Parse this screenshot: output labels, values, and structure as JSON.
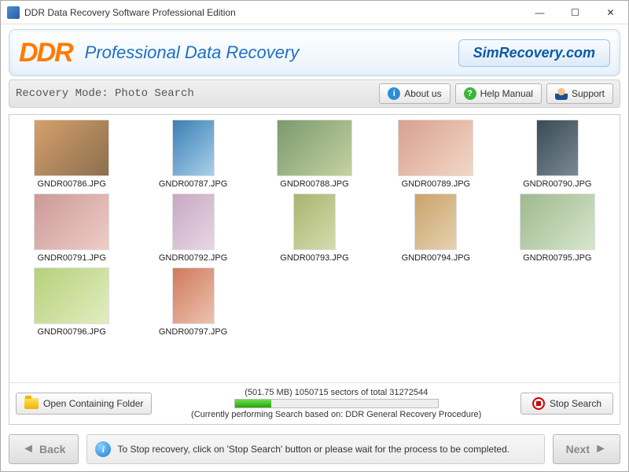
{
  "window": {
    "title": "DDR Data Recovery Software Professional Edition"
  },
  "banner": {
    "logo": "DDR",
    "title": "Professional Data Recovery",
    "brand": "SimRecovery.com"
  },
  "toolbar": {
    "mode_label": "Recovery Mode: Photo Search",
    "about": "About us",
    "help": "Help Manual",
    "support": "Support"
  },
  "files": [
    {
      "name": "GNDR00786.JPG",
      "orient": "land"
    },
    {
      "name": "GNDR00787.JPG",
      "orient": "port"
    },
    {
      "name": "GNDR00788.JPG",
      "orient": "land"
    },
    {
      "name": "GNDR00789.JPG",
      "orient": "land"
    },
    {
      "name": "GNDR00790.JPG",
      "orient": "port"
    },
    {
      "name": "GNDR00791.JPG",
      "orient": "land"
    },
    {
      "name": "GNDR00792.JPG",
      "orient": "port"
    },
    {
      "name": "GNDR00793.JPG",
      "orient": "port"
    },
    {
      "name": "GNDR00794.JPG",
      "orient": "port"
    },
    {
      "name": "GNDR00795.JPG",
      "orient": "land"
    },
    {
      "name": "GNDR00796.JPG",
      "orient": "land"
    },
    {
      "name": "GNDR00797.JPG",
      "orient": "port"
    }
  ],
  "progress": {
    "open_folder": "Open Containing Folder",
    "status": "(501.75 MB) 1050715  sectors  of  total 31272544",
    "note": "(Currently performing Search based on:  DDR General Recovery Procedure)",
    "stop": "Stop Search"
  },
  "footer": {
    "back": "Back",
    "next": "Next",
    "info": "To Stop recovery, click on 'Stop Search' button or please wait for the process to be completed."
  }
}
